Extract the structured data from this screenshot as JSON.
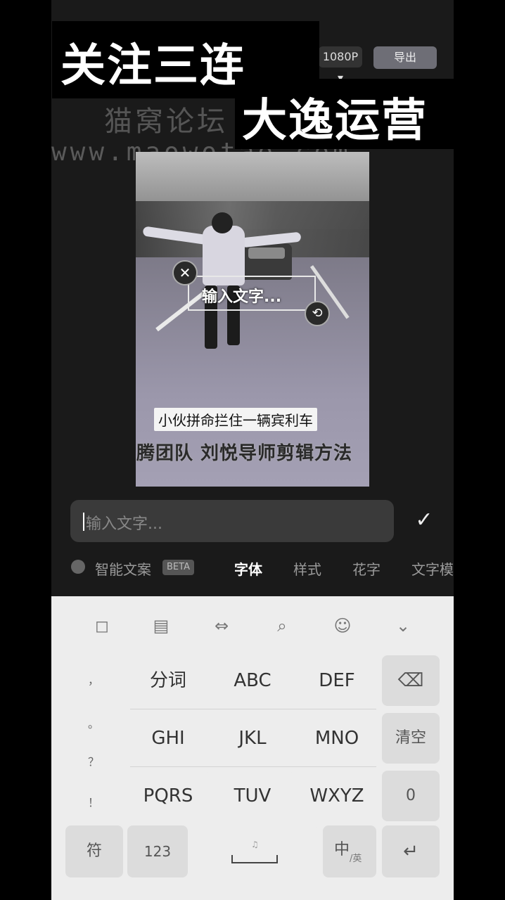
{
  "overlay": {
    "title_line1": "关注三连",
    "title_line2": "大逸运营"
  },
  "topbar": {
    "resolution_label": "1080P ▾",
    "export_label": "导出"
  },
  "watermark": {
    "brand": "猫窝论坛",
    "url": "www.maowotao.com"
  },
  "preview": {
    "textbox_placeholder": "输入文字...",
    "caption_line1": "小伙拼命拦住一辆宾利车",
    "caption_line2": "飞腾团队 刘悦导师剪辑方法"
  },
  "input": {
    "placeholder": "输入文字..."
  },
  "tabs": {
    "smart": "智能文案",
    "beta": "BETA",
    "font": "字体",
    "style": "样式",
    "fancy": "花字",
    "template": "文字模板"
  },
  "keyboard": {
    "tools": [
      "clipboard",
      "keyboard",
      "cursor",
      "search",
      "emoji",
      "collapse"
    ],
    "punctuation": [
      "，",
      "。",
      "？",
      "！"
    ],
    "row1": [
      "分词",
      "ABC",
      "DEF"
    ],
    "row2": [
      "GHI",
      "JKL",
      "MNO"
    ],
    "row3": [
      "PQRS",
      "TUV",
      "WXYZ"
    ],
    "clear": "清空",
    "zero": "0",
    "symbols": "符",
    "num": "123",
    "lang": "中",
    "lang_sub": "/英",
    "enter": "↵",
    "backspace": "⌫"
  }
}
